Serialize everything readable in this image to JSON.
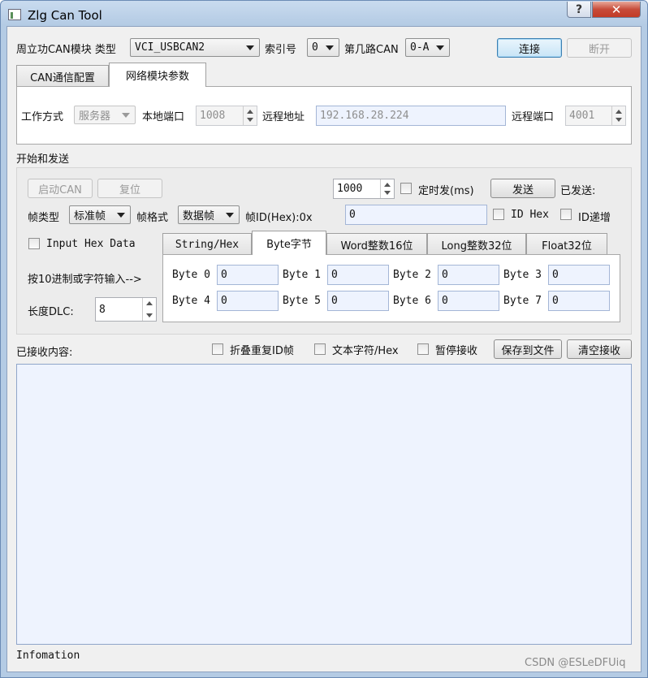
{
  "window": {
    "title": "Zlg Can Tool",
    "help_label": "?",
    "close_label": "✕"
  },
  "conn": {
    "module_label": "周立功CAN模块 类型",
    "type_value": "VCI_USBCAN2",
    "index_label": "索引号",
    "index_value": "0",
    "channel_label": "第几路CAN",
    "channel_value": "0-A",
    "connect_label": "连接",
    "disconnect_label": "断开"
  },
  "tabs": {
    "can_config": "CAN通信配置",
    "net_params": "网络模块参数"
  },
  "net": {
    "mode_label": "工作方式",
    "mode_value": "服务器",
    "local_port_label": "本地端口",
    "local_port_value": "1008",
    "remote_addr_label": "远程地址",
    "remote_addr_value": "192.168.28.224",
    "remote_port_label": "远程端口",
    "remote_port_value": "4001"
  },
  "send": {
    "section_label": "开始和发送",
    "start_can_label": "启动CAN",
    "reset_label": "复位",
    "interval_value": "1000",
    "timer_label": "定时发(ms)",
    "send_label": "发送",
    "sent_label": "已发送:",
    "frame_type_label": "帧类型",
    "frame_type_value": "标准帧",
    "frame_format_label": "帧格式",
    "frame_format_value": "数据帧",
    "frame_id_label": "帧ID(Hex):0x",
    "frame_id_value": "0",
    "id_hex_label": "ID Hex",
    "id_inc_label": "ID递增",
    "input_hex_label": "Input Hex Data",
    "hint_label": "按10进制或字符输入-->",
    "dlc_label": "长度DLC:",
    "dlc_value": "8"
  },
  "data_tabs": [
    "String/Hex",
    "Byte字节",
    "Word整数16位",
    "Long整数32位",
    "Float32位"
  ],
  "bytes": [
    {
      "label": "Byte 0",
      "value": "0"
    },
    {
      "label": "Byte 1",
      "value": "0"
    },
    {
      "label": "Byte 2",
      "value": "0"
    },
    {
      "label": "Byte 3",
      "value": "0"
    },
    {
      "label": "Byte 4",
      "value": "0"
    },
    {
      "label": "Byte 5",
      "value": "0"
    },
    {
      "label": "Byte 6",
      "value": "0"
    },
    {
      "label": "Byte 7",
      "value": "0"
    }
  ],
  "recv": {
    "label": "已接收内容:",
    "fold_label": "折叠重复ID帧",
    "text_hex_label": "文本字符/Hex",
    "pause_label": "暂停接收",
    "save_label": "保存到文件",
    "clear_label": "清空接收"
  },
  "footer": {
    "info_label": "Infomation",
    "watermark": "CSDN @ESLeDFUiq"
  }
}
